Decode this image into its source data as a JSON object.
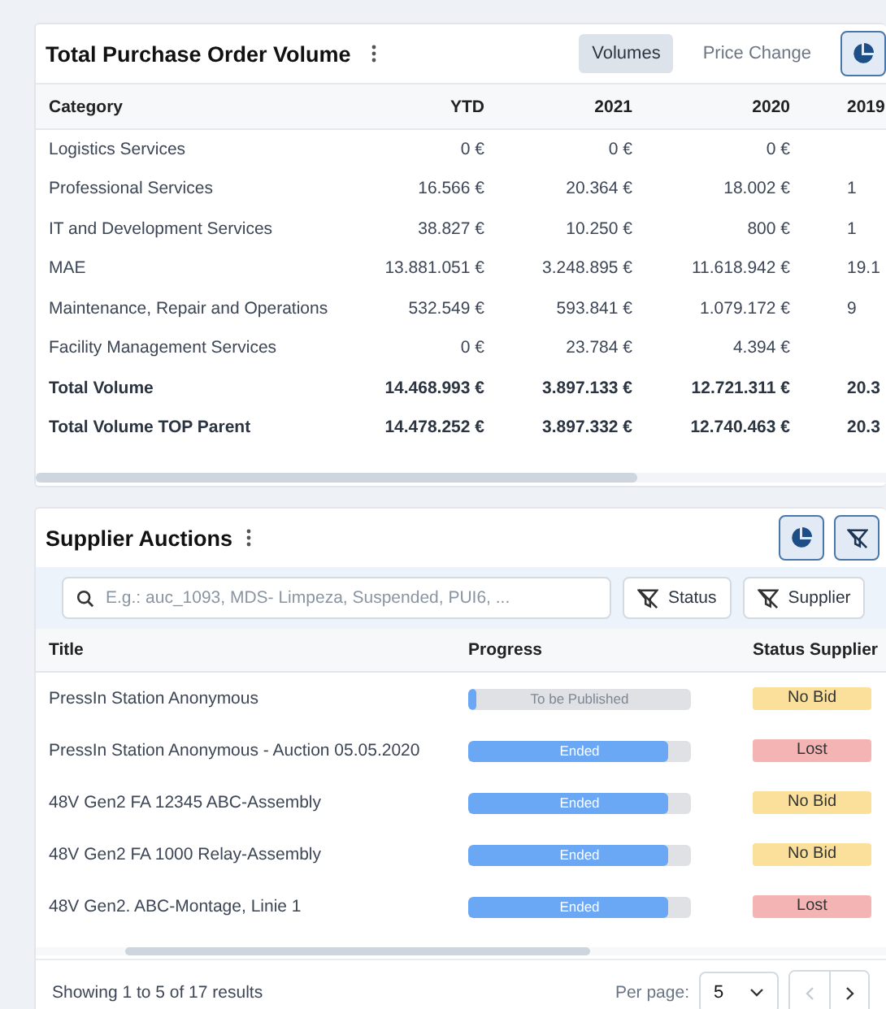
{
  "volume_card": {
    "title": "Total Purchase Order Volume",
    "view_tabs": [
      {
        "label": "Volumes",
        "selected": true
      },
      {
        "label": "Price Change",
        "selected": false
      }
    ],
    "table": {
      "columns": [
        "Category",
        "YTD",
        "2021",
        "2020",
        "2019"
      ],
      "rows": [
        {
          "kind": "normal",
          "cells": [
            "Logistics Services",
            "0 €",
            "0 €",
            "0 €"
          ]
        },
        {
          "kind": "normal",
          "cells": [
            "Professional Services",
            "16.566 €",
            "20.364 €",
            "18.002 €",
            "1"
          ]
        },
        {
          "kind": "normal",
          "cells": [
            "IT and Development Services",
            "38.827 €",
            "10.250 €",
            "800 €",
            "1"
          ]
        },
        {
          "kind": "normal",
          "cells": [
            "MAE",
            "13.881.051 €",
            "3.248.895 €",
            "11.618.942 €",
            "19.1"
          ]
        },
        {
          "kind": "normal",
          "cells": [
            "Maintenance, Repair and Operations",
            "532.549 €",
            "593.841 €",
            "1.079.172 €",
            "9"
          ]
        },
        {
          "kind": "normal",
          "cells": [
            "Facility Management Services",
            "0 €",
            "23.784 €",
            "4.394 €"
          ]
        },
        {
          "kind": "total",
          "cells": [
            "Total Volume",
            "14.468.993 €",
            "3.897.133 €",
            "12.721.311 €",
            "20.3"
          ]
        },
        {
          "kind": "total",
          "cells": [
            "Total Volume TOP Parent",
            "14.478.252 €",
            "3.897.332 €",
            "12.740.463 €",
            "20.3"
          ]
        }
      ]
    }
  },
  "auctions_card": {
    "title": "Supplier Auctions",
    "search": {
      "placeholder": "E.g.: auc_1093, MDS- Limpeza, Suspended, PUI6, ..."
    },
    "filters": [
      "Status",
      "Supplier"
    ],
    "table": {
      "columns": [
        "Title",
        "Progress",
        "Status Supplier"
      ],
      "rows": [
        {
          "title": "PressIn Station Anonymous",
          "progress": "To be Published",
          "level": 0.04,
          "status": "No Bid",
          "color": "#fbe09c"
        },
        {
          "title": "PressIn Station Anonymous - Auction 05.05.2020",
          "progress": "Ended",
          "level": 0.9,
          "status": "Lost",
          "color": "#f4b4b4"
        },
        {
          "title": "48V Gen2 FA 12345 ABC-Assembly",
          "progress": "Ended",
          "level": 0.9,
          "status": "No Bid",
          "color": "#fbe09c"
        },
        {
          "title": "48V Gen2 FA 1000 Relay-Assembly",
          "progress": "Ended",
          "level": 0.9,
          "status": "No Bid",
          "color": "#fbe09c"
        },
        {
          "title": "48V Gen2. ABC-Montage, Linie 1",
          "progress": "Ended",
          "level": 0.9,
          "status": "Lost",
          "color": "#f4b4b4"
        }
      ]
    },
    "footer": {
      "summary": "Showing 1 to 5 of 17 results",
      "per_page_label": "Per page:",
      "per_page": "5",
      "prev_disabled": true,
      "next_disabled": false
    }
  }
}
